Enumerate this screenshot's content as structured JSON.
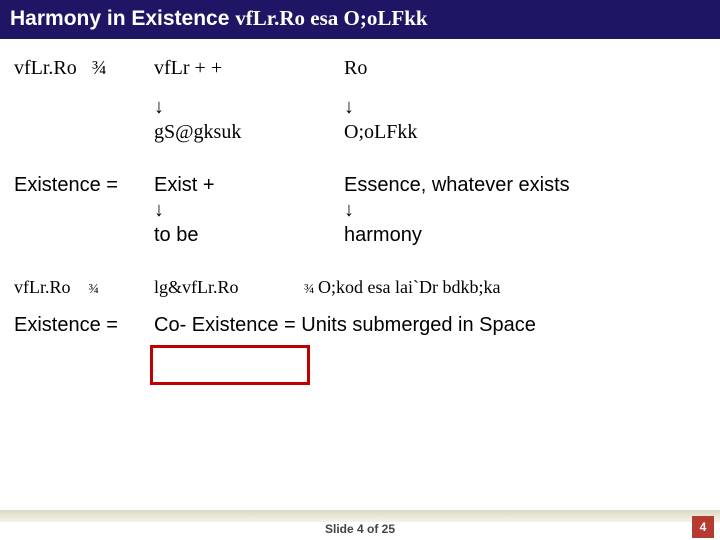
{
  "title": {
    "part1": "Harmony in Existence ",
    "part2": "vfLr.Ro esa O;oLFkk"
  },
  "l1": {
    "c1a": "vfLr.Ro",
    "c1b": "¾",
    "c2": "vfLr  + +",
    "c3": "Ro"
  },
  "l2": {
    "c2": "↓",
    "c3": "↓"
  },
  "l3": {
    "c2": "gS@gksuk",
    "c3": "O;oLFkk"
  },
  "l4": {
    "c1": "Existence =",
    "c2": "Exist  +",
    "c3": "Essence, whatever exists"
  },
  "l5": {
    "c2": "↓",
    "c3": "↓"
  },
  "l6": {
    "c2": "to be",
    "c3": "harmony"
  },
  "l7": {
    "c1a": "vfLr.Ro",
    "c1b": "¾",
    "c2": "lg&vfLr.Ro",
    "c3a": "¾ ",
    "c3b": "O;kod esa lai`Dr bdkb;ka"
  },
  "l8": {
    "c1": "Existence =",
    "rest": "Co- Existence =  Units submerged in Space"
  },
  "footer": {
    "text": "Slide 4 of 25",
    "num": "4"
  }
}
